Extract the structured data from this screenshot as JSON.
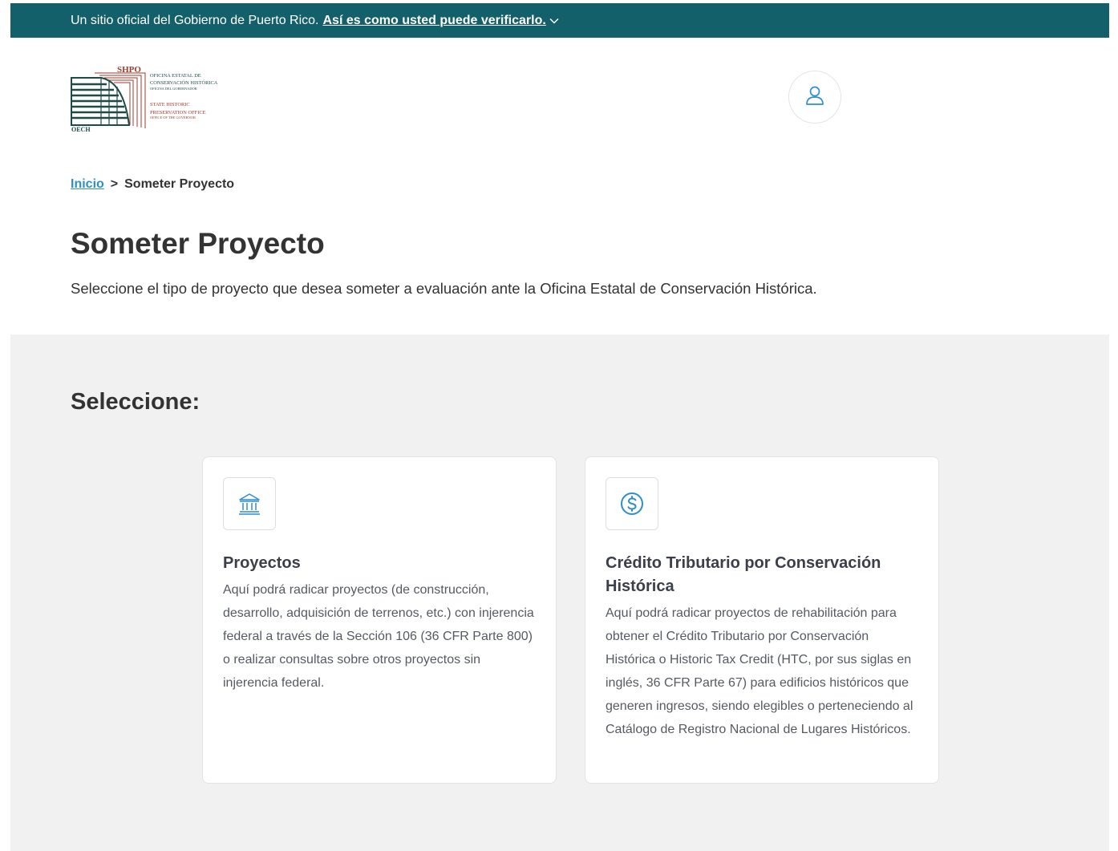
{
  "banner": {
    "text": "Un sitio oficial del Gobierno de Puerto Rico.",
    "link": "Así es como usted puede verificarlo."
  },
  "logo": {
    "acronym": "SHPO",
    "line1": "OFICINA ESTATAL DE",
    "line2": "CONSERVACIÓN HISTÓRICA",
    "line3": "OFICINA DEL GOBERNADOR",
    "line4": "STATE HISTORIC",
    "line5": "PRESERVATION OFFICE",
    "line6": "OFFICE OF THE GOVERNOR",
    "short": "OECH"
  },
  "breadcrumb": {
    "home": "Inicio",
    "separator": ">",
    "current": "Someter Proyecto"
  },
  "page": {
    "title": "Someter Proyecto",
    "intro": "Seleccione el tipo de proyecto que desea someter a evaluación ante la Oficina Estatal de Conservación Histórica."
  },
  "select": {
    "heading": "Seleccione:",
    "cards": [
      {
        "icon": "bank-icon",
        "title": "Proyectos",
        "body": "Aquí podrá radicar proyectos (de construcción, desarrollo, adquisición de terrenos, etc.) con injerencia federal a través de la Sección 106 (36 CFR Parte 800) o realizar consultas sobre otros proyectos sin injerencia federal."
      },
      {
        "icon": "dollar-icon",
        "title": "Crédito Tributario por Conservación Histórica",
        "body": "Aquí podrá radicar proyectos de rehabilitación para obtener el Crédito Tributario por Conservación Histórica o Historic Tax Credit (HTC, por sus siglas en inglés, 36 CFR Parte 67) para edificios históricos que generen ingresos, siendo elegibles o perteneciendo al Catálogo de Registro Nacional de Lugares Históricos."
      }
    ]
  },
  "colors": {
    "banner_bg": "#14606a",
    "accent": "#2f8fc9",
    "logo_red": "#a23a2c",
    "logo_dark": "#1e4a47",
    "section_bg": "#f1f1f1"
  }
}
